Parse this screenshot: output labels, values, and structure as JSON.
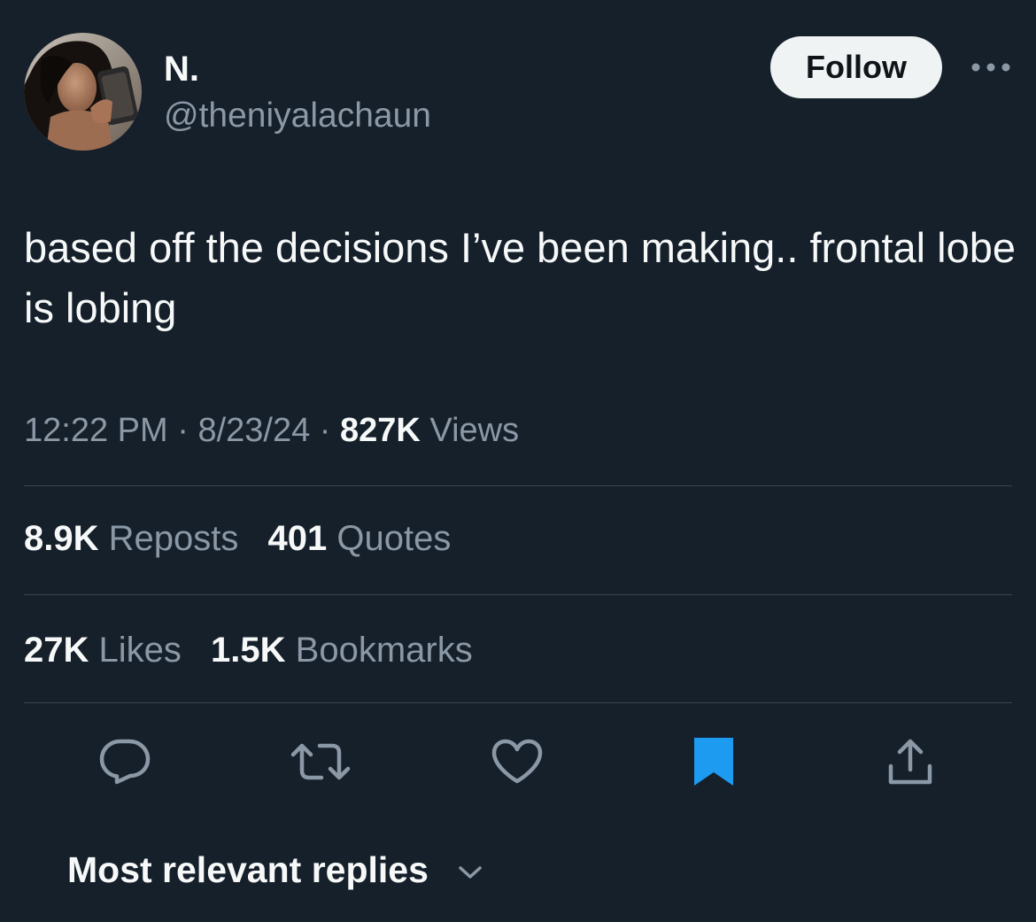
{
  "author": {
    "display_name": "N.",
    "handle": "@theniyalachaun",
    "avatar_icon": "profile-photo"
  },
  "header": {
    "follow_label": "Follow",
    "more_icon": "more-horizontal-icon"
  },
  "tweet": {
    "text": "based off the decisions I’ve been making.. frontal lobe is lobing",
    "time": "12:22 PM",
    "separator": "·",
    "date": "8/23/24",
    "views_count": "827K",
    "views_label": "Views"
  },
  "stats": {
    "reposts_count": "8.9K",
    "reposts_label": "Reposts",
    "quotes_count": "401",
    "quotes_label": "Quotes",
    "likes_count": "27K",
    "likes_label": "Likes",
    "bookmarks_count": "1.5K",
    "bookmarks_label": "Bookmarks"
  },
  "actions": [
    {
      "icon": "reply-icon"
    },
    {
      "icon": "repost-icon"
    },
    {
      "icon": "like-icon"
    },
    {
      "icon": "bookmark-icon",
      "active": true
    },
    {
      "icon": "share-icon"
    }
  ],
  "replies": {
    "sort_label": "Most relevant replies",
    "chevron_icon": "chevron-down-icon"
  },
  "colors": {
    "background": "#15202b",
    "text_primary": "#f7f9f9",
    "text_secondary": "#8b98a5",
    "divider": "#38444d",
    "accent": "#1d9bf0",
    "follow_button_bg": "#eff3f4"
  }
}
